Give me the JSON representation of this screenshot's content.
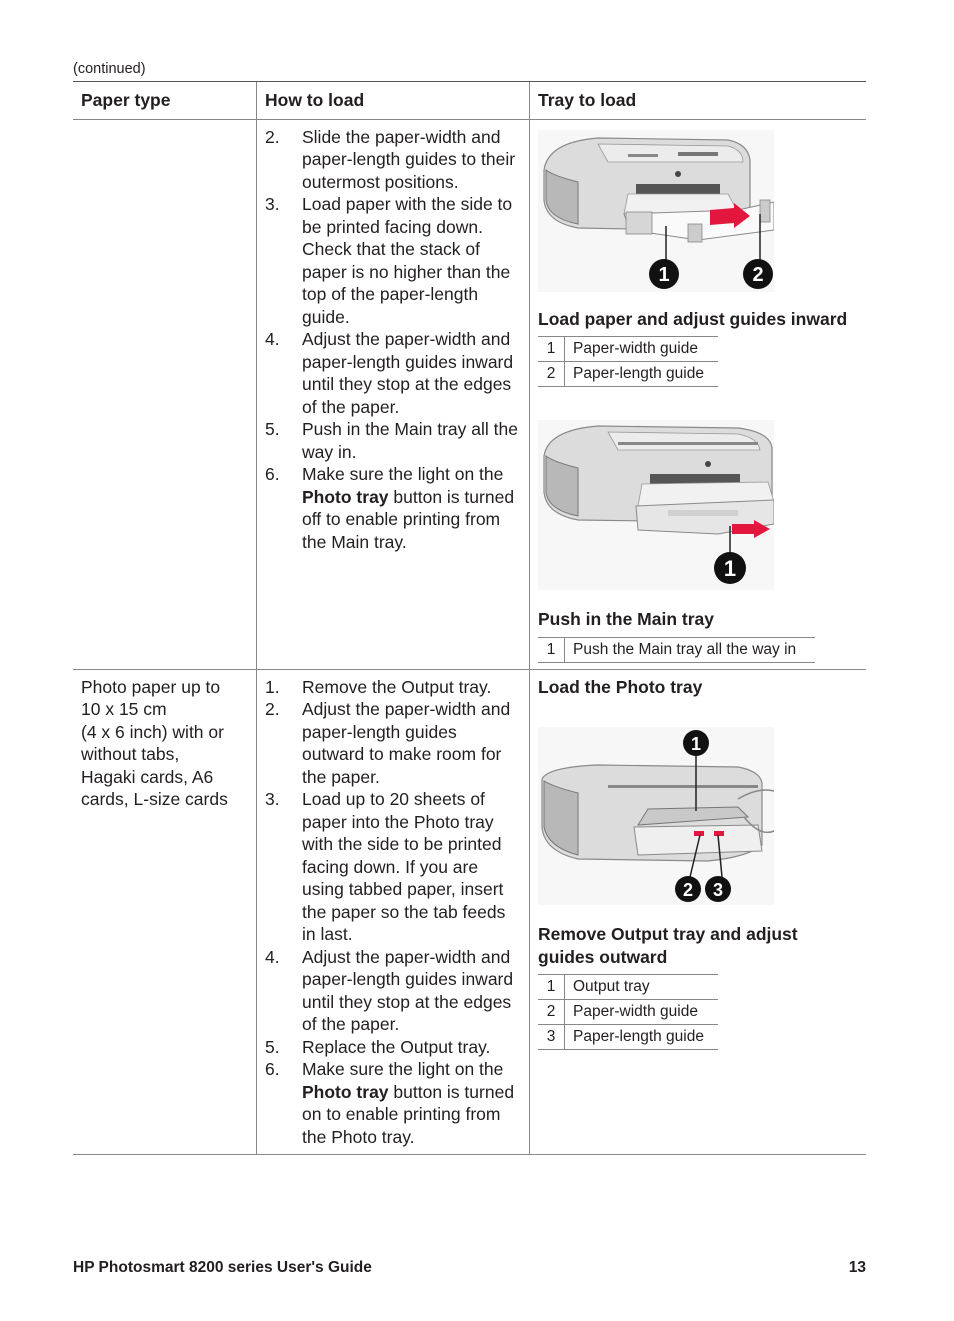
{
  "continued_label": "(continued)",
  "table": {
    "headers": [
      "Paper type",
      "How to load",
      "Tray to load"
    ],
    "rows": [
      {
        "paper_type": "",
        "steps": [
          {
            "num": "2.",
            "text": "Slide the paper-width and paper-length guides to their outermost positions."
          },
          {
            "num": "3.",
            "text": "Load paper with the side to be printed facing down. Check that the stack of paper is no higher than the top of the paper-length guide."
          },
          {
            "num": "4.",
            "text": "Adjust the paper-width and paper-length guides inward until they stop at the edges of the paper."
          },
          {
            "num": "5.",
            "text": "Push in the Main tray all the way in."
          },
          {
            "num": "6.",
            "pre": "Make sure the light on the ",
            "bold": "Photo tray",
            "post": " button is turned off to enable printing from the Main tray."
          }
        ],
        "figures": [
          {
            "image": "printer-main-tray-load-illustration",
            "callouts": [
              "1",
              "2"
            ],
            "caption": "Load paper and adjust guides inward",
            "legend": [
              {
                "num": "1",
                "label": "Paper-width guide"
              },
              {
                "num": "2",
                "label": "Paper-length guide"
              }
            ]
          },
          {
            "image": "printer-push-main-tray-illustration",
            "callouts": [
              "1"
            ],
            "caption": "Push in the Main tray",
            "legend": [
              {
                "num": "1",
                "label": "Push the Main tray all the way in"
              }
            ]
          }
        ]
      },
      {
        "paper_type": "Photo paper up to 10 x 15 cm (4 x 6 inch) with or without tabs, Hagaki cards, A6 cards, L-size cards",
        "paper_type_lines": [
          "Photo paper up to",
          "10 x 15 cm",
          "(4 x 6 inch) with or",
          "without tabs,",
          "Hagaki cards, A6",
          "cards, L-size cards"
        ],
        "steps": [
          {
            "num": "1.",
            "text": "Remove the Output tray."
          },
          {
            "num": "2.",
            "text": "Adjust the paper-width and paper-length guides outward to make room for the paper."
          },
          {
            "num": "3.",
            "text": "Load up to 20 sheets of paper into the Photo tray with the side to be printed facing down. If you are using tabbed paper, insert the paper so the tab feeds in last."
          },
          {
            "num": "4.",
            "text": "Adjust the paper-width and paper-length guides inward until they stop at the edges of the paper."
          },
          {
            "num": "5.",
            "text": "Replace the Output tray."
          },
          {
            "num": "6.",
            "pre": "Make sure the light on the ",
            "bold": "Photo tray",
            "post": " button is turned on to enable printing from the Photo tray."
          }
        ],
        "tray_heading": "Load the Photo tray",
        "figures": [
          {
            "image": "printer-photo-tray-illustration",
            "callouts": [
              "1",
              "2",
              "3"
            ],
            "caption": "Remove Output tray and adjust guides outward",
            "legend": [
              {
                "num": "1",
                "label": "Output tray"
              },
              {
                "num": "2",
                "label": "Paper-width guide"
              },
              {
                "num": "3",
                "label": "Paper-length guide"
              }
            ]
          }
        ]
      }
    ]
  },
  "footer": {
    "title": "HP Photosmart 8200 series User's Guide",
    "page_number": "13"
  },
  "colors": {
    "text": "#231f20",
    "rule": "#888888",
    "arrow": "#e3173e",
    "callout": "#111111"
  }
}
